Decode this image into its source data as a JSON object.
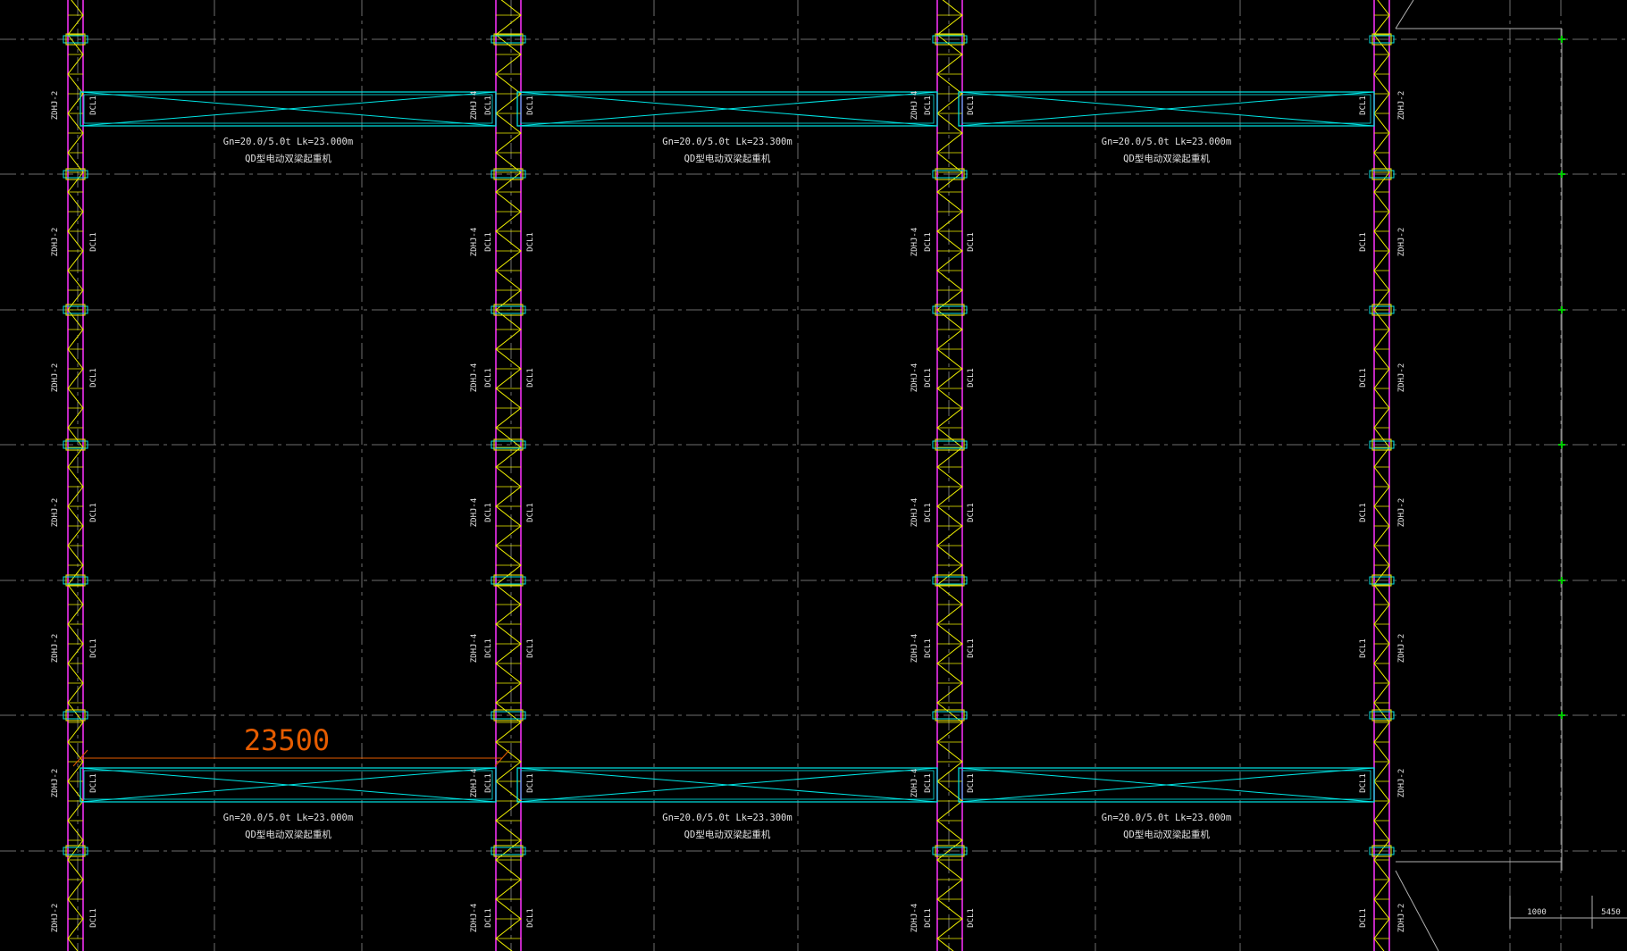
{
  "drawing": {
    "background": "#000000",
    "colors": {
      "grid_line": "#6e6e6e",
      "truss_chord": "#ff33ff",
      "truss_web": "#f2f200",
      "crane": "#00e5e5",
      "text": "#e0e0e0",
      "dimension": "#e65c00",
      "edge_line": "#b0b0b0",
      "tick_mark": "#00cc00"
    },
    "column_labels": {
      "outer_column": "ZDHJ-2",
      "inner_column": "ZDHJ-4",
      "crane_column": "DCL1"
    },
    "cranes": [
      {
        "spec": "Gn=20.0/5.0t Lk=23.000m",
        "name": "QD型电动双梁起重机"
      },
      {
        "spec": "Gn=20.0/5.0t Lk=23.300m",
        "name": "QD型电动双梁起重机"
      },
      {
        "spec": "Gn=20.0/5.0t Lk=23.000m",
        "name": "QD型电动双梁起重机"
      },
      {
        "spec": "Gn=20.0/5.0t Lk=23.000m",
        "name": "QD型电动双梁起重机"
      },
      {
        "spec": "Gn=20.0/5.0t Lk=23.300m",
        "name": "QD型电动双梁起重机"
      },
      {
        "spec": "Gn=20.0/5.0t Lk=23.000m",
        "name": "QD型电动双梁起重机"
      }
    ],
    "dimension": {
      "value": "23500"
    },
    "bottom_right_dims": [
      "1000",
      "5450"
    ]
  }
}
